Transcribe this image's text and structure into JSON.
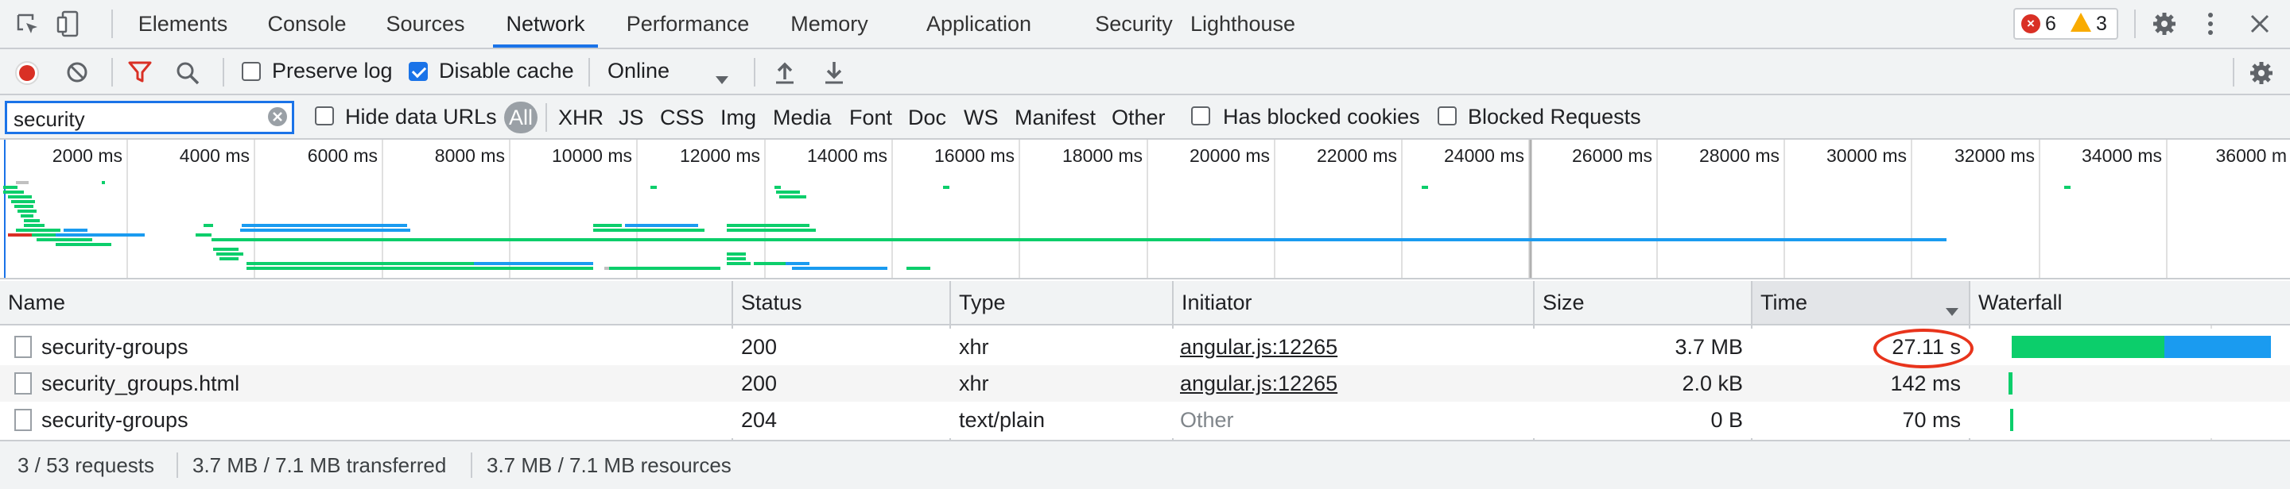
{
  "tabs": [
    {
      "label": "Elements",
      "active": false
    },
    {
      "label": "Console",
      "active": false
    },
    {
      "label": "Sources",
      "active": false
    },
    {
      "label": "Network",
      "active": true
    },
    {
      "label": "Performance",
      "active": false
    },
    {
      "label": "Memory",
      "active": false
    },
    {
      "label": "Application",
      "active": false
    },
    {
      "label": "Security",
      "active": false
    },
    {
      "label": "Lighthouse",
      "active": false
    }
  ],
  "issues": {
    "errors": "6",
    "warnings": "3"
  },
  "toolbar": {
    "preserve_log": {
      "label": "Preserve log",
      "checked": false
    },
    "disable_cache": {
      "label": "Disable cache",
      "checked": true
    },
    "throttling": "Online"
  },
  "filter": {
    "value": "security",
    "hide_data_urls": {
      "label": "Hide data URLs",
      "checked": false
    },
    "types": [
      "All",
      "XHR",
      "JS",
      "CSS",
      "Img",
      "Media",
      "Font",
      "Doc",
      "WS",
      "Manifest",
      "Other"
    ],
    "active_type": "All",
    "has_blocked_cookies": {
      "label": "Has blocked cookies",
      "checked": false
    },
    "blocked_requests": {
      "label": "Blocked Requests",
      "checked": false
    }
  },
  "overview": {
    "ticks": [
      "2000 ms",
      "4000 ms",
      "6000 ms",
      "8000 ms",
      "10000 ms",
      "12000 ms",
      "14000 ms",
      "16000 ms",
      "18000 ms",
      "20000 ms",
      "22000 ms",
      "24000 ms",
      "26000 ms",
      "28000 ms",
      "30000 ms",
      "32000 ms",
      "34000 ms",
      "36000 m"
    ]
  },
  "table": {
    "columns": [
      "Name",
      "Status",
      "Type",
      "Initiator",
      "Size",
      "Time",
      "Waterfall"
    ],
    "sort_column": "Time",
    "rows": [
      {
        "name": "security-groups",
        "status": "200",
        "type": "xhr",
        "initiator": "angular.js:12265",
        "initiator_link": true,
        "size": "3.7 MB",
        "time": "27.11 s",
        "highlighted": true
      },
      {
        "name": "security_groups.html",
        "status": "200",
        "type": "xhr",
        "initiator": "angular.js:12265",
        "initiator_link": true,
        "size": "2.0 kB",
        "time": "142 ms",
        "highlighted": false
      },
      {
        "name": "security-groups",
        "status": "204",
        "type": "text/plain",
        "initiator": "Other",
        "initiator_link": false,
        "size": "0 B",
        "time": "70 ms",
        "highlighted": false
      }
    ]
  },
  "status_bar": {
    "requests": "3 / 53 requests",
    "transferred": "3.7 MB / 7.1 MB transferred",
    "resources": "3.7 MB / 7.1 MB resources"
  },
  "colors": {
    "accent": "#1a73e8",
    "record": "#d93025",
    "filter_icon": "#d93025",
    "waiting": "#0cce6b",
    "download": "#1a9bf0",
    "annotation": "#e8341c"
  }
}
